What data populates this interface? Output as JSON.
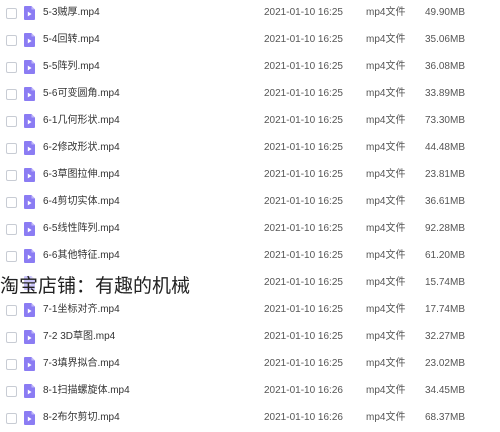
{
  "colors": {
    "file_icon": "#8b7cf3",
    "checkbox_border": "#c8ccd4",
    "text": "#333333"
  },
  "file_icon_name": "video-file-icon",
  "files": [
    {
      "name": "5-3贼厚.mp4",
      "date": "2021-01-10 16:25",
      "type": "mp4文件",
      "size": "49.90MB"
    },
    {
      "name": "5-4回转.mp4",
      "date": "2021-01-10 16:25",
      "type": "mp4文件",
      "size": "35.06MB"
    },
    {
      "name": "5-5阵列.mp4",
      "date": "2021-01-10 16:25",
      "type": "mp4文件",
      "size": "36.08MB"
    },
    {
      "name": "5-6可变圆角.mp4",
      "date": "2021-01-10 16:25",
      "type": "mp4文件",
      "size": "33.89MB"
    },
    {
      "name": "6-1几何形状.mp4",
      "date": "2021-01-10 16:25",
      "type": "mp4文件",
      "size": "73.30MB"
    },
    {
      "name": "6-2修改形状.mp4",
      "date": "2021-01-10 16:25",
      "type": "mp4文件",
      "size": "44.48MB"
    },
    {
      "name": "6-3草图拉伸.mp4",
      "date": "2021-01-10 16:25",
      "type": "mp4文件",
      "size": "23.81MB"
    },
    {
      "name": "6-4剪切实体.mp4",
      "date": "2021-01-10 16:25",
      "type": "mp4文件",
      "size": "36.61MB"
    },
    {
      "name": "6-5线性阵列.mp4",
      "date": "2021-01-10 16:25",
      "type": "mp4文件",
      "size": "92.28MB"
    },
    {
      "name": "6-6其他特征.mp4",
      "date": "2021-01-10 16:25",
      "type": "mp4文件",
      "size": "61.20MB"
    },
    {
      "name": "",
      "date": "2021-01-10 16:25",
      "type": "mp4文件",
      "size": "15.74MB"
    },
    {
      "name": "7-1坐标对齐.mp4",
      "date": "2021-01-10 16:25",
      "type": "mp4文件",
      "size": "17.74MB"
    },
    {
      "name": "7-2 3D草图.mp4",
      "date": "2021-01-10 16:25",
      "type": "mp4文件",
      "size": "32.27MB"
    },
    {
      "name": "7-3填界拟合.mp4",
      "date": "2021-01-10 16:25",
      "type": "mp4文件",
      "size": "23.02MB"
    },
    {
      "name": "8-1扫描螺旋体.mp4",
      "date": "2021-01-10 16:26",
      "type": "mp4文件",
      "size": "34.45MB"
    },
    {
      "name": "8-2布尔剪切.mp4",
      "date": "2021-01-10 16:26",
      "type": "mp4文件",
      "size": "68.37MB"
    }
  ],
  "watermark": "淘宝店铺：有趣的机械"
}
